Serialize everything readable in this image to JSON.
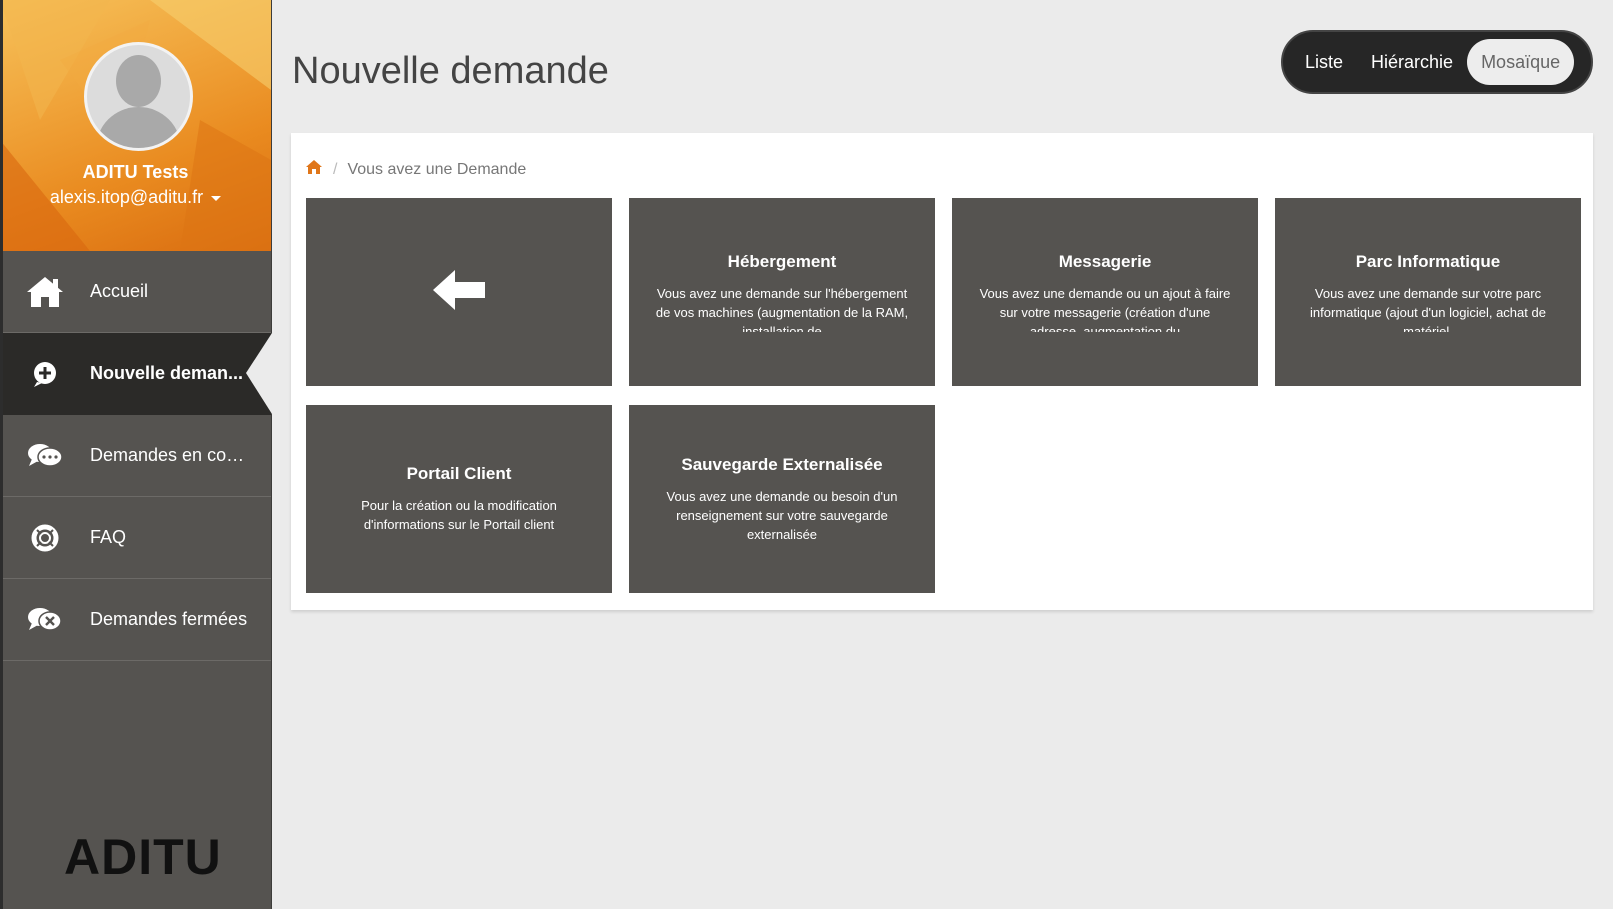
{
  "profile": {
    "name": "ADITU Tests",
    "email": "alexis.itop@aditu.fr"
  },
  "nav": {
    "items": [
      {
        "label": "Accueil",
        "icon": "home-icon"
      },
      {
        "label": "Nouvelle deman...",
        "icon": "plus-circle-icon"
      },
      {
        "label": "Demandes en cours",
        "icon": "chat-bubbles-icon"
      },
      {
        "label": "FAQ",
        "icon": "lifebuoy-icon"
      },
      {
        "label": "Demandes fermées",
        "icon": "chat-close-icon"
      }
    ]
  },
  "brand": {
    "logo": "ADITU",
    "accent": "#e98a1f"
  },
  "page": {
    "title": "Nouvelle demande"
  },
  "view_switch": {
    "options": [
      "Liste",
      "Hiérarchie",
      "Mosaïque"
    ],
    "active": "Mosaïque"
  },
  "breadcrumb": {
    "current": "Vous avez une Demande"
  },
  "tiles": [
    {
      "title": "Hébergement",
      "desc": "Vous avez une demande sur l'hébergement de vos machines (augmentation de la RAM, installation de"
    },
    {
      "title": "Messagerie",
      "desc": "Vous avez une demande ou un ajout à faire sur votre messagerie (création d'une adresse, augmentation du"
    },
    {
      "title": "Parc Informatique",
      "desc": "Vous avez une demande sur votre parc informatique (ajout d'un logiciel, achat de matériel,"
    },
    {
      "title": "Portail Client",
      "desc": "Pour la création ou la modification d'informations sur le Portail client"
    },
    {
      "title": "Sauvegarde Externalisée",
      "desc": "Vous avez une demande ou besoin d'un renseignement sur votre sauvegarde externalisée"
    }
  ]
}
